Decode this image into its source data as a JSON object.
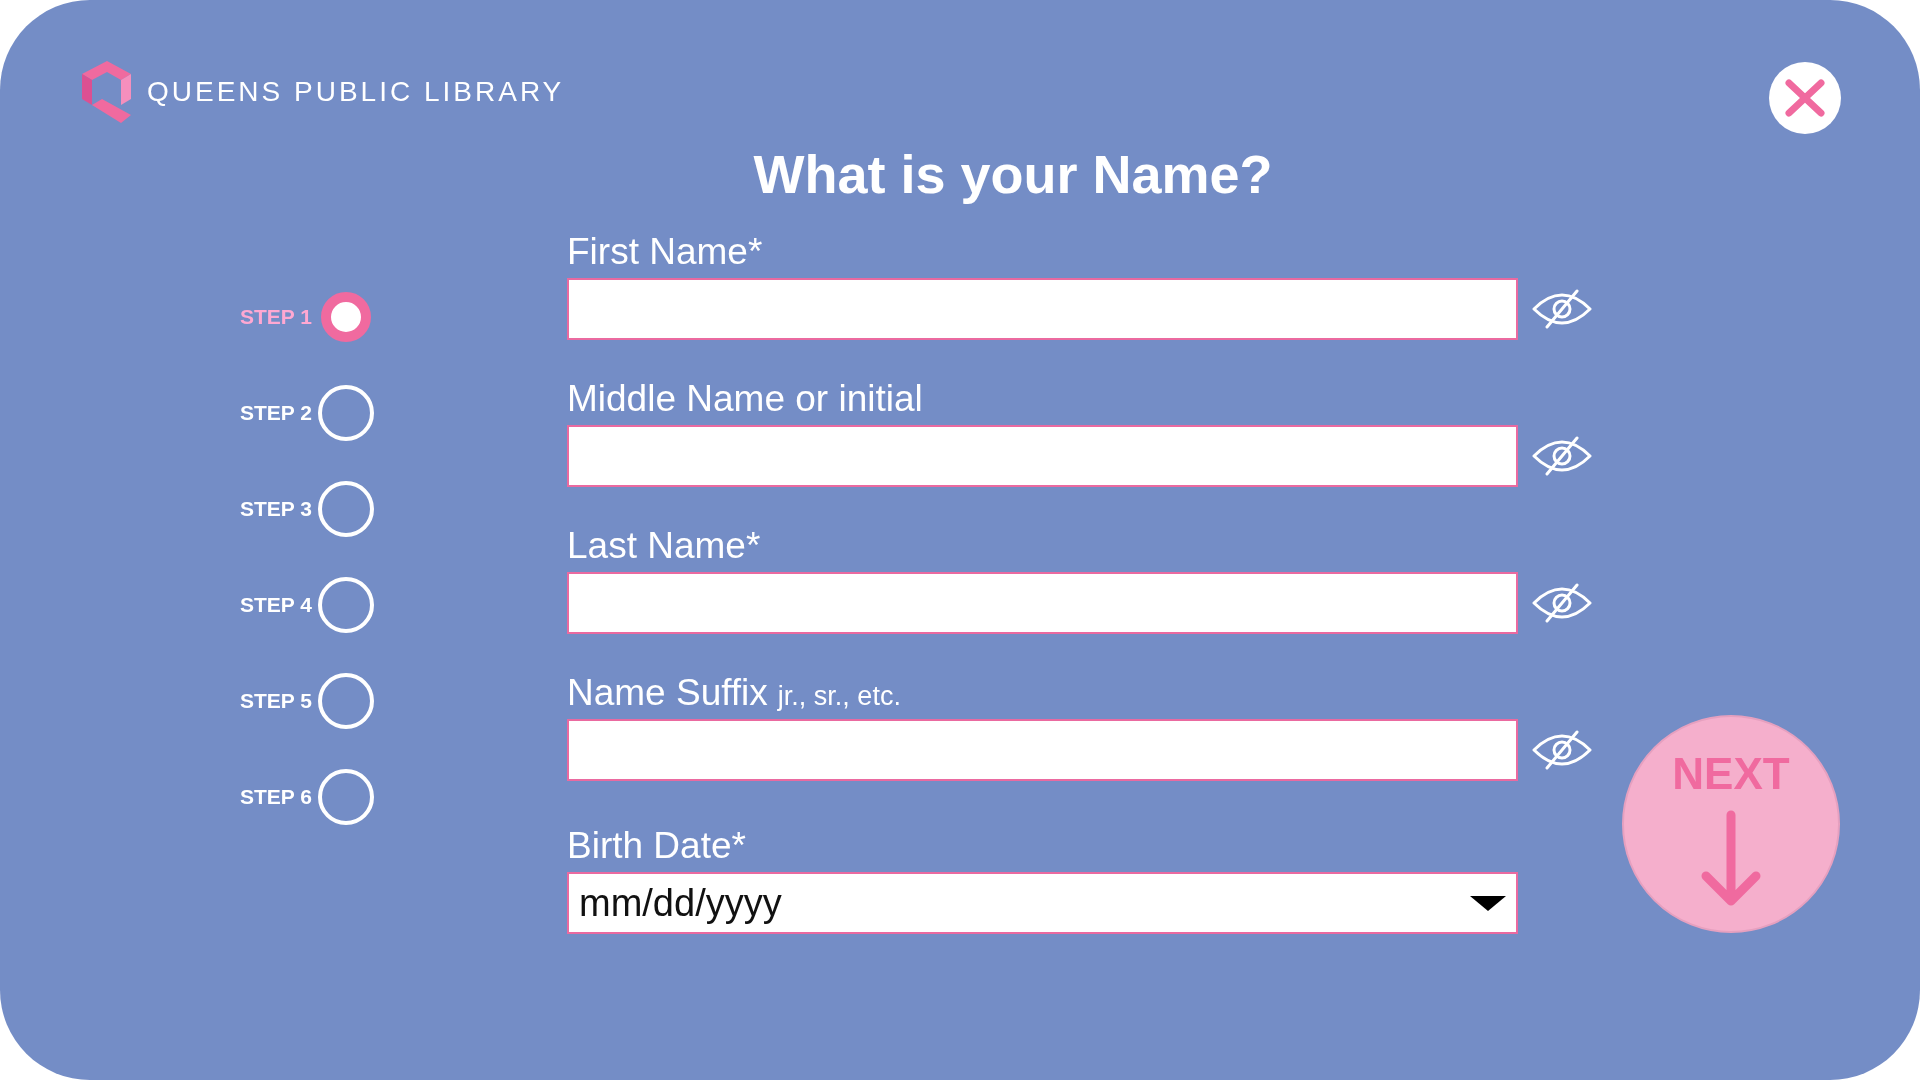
{
  "header": {
    "logo_text": "QUEENS PUBLIC LIBRARY"
  },
  "title": "What is your Name?",
  "steps": [
    {
      "label": "STEP 1",
      "selected": true
    },
    {
      "label": "STEP 2",
      "selected": false
    },
    {
      "label": "STEP 3",
      "selected": false
    },
    {
      "label": "STEP 4",
      "selected": false
    },
    {
      "label": "STEP 5",
      "selected": false
    },
    {
      "label": "STEP 6",
      "selected": false
    }
  ],
  "fields": [
    {
      "kind": "text",
      "label": "First Name*"
    },
    {
      "kind": "text",
      "label": "Middle Name or initial"
    },
    {
      "kind": "text",
      "label": "Last Name*"
    },
    {
      "kind": "text",
      "label": "Name Suffix",
      "hint": "jr., sr., etc."
    },
    {
      "kind": "date",
      "label": "Birth Date*",
      "placeholder": "mm/dd/yyyy"
    }
  ],
  "next_button": {
    "label": "NEXT"
  }
}
